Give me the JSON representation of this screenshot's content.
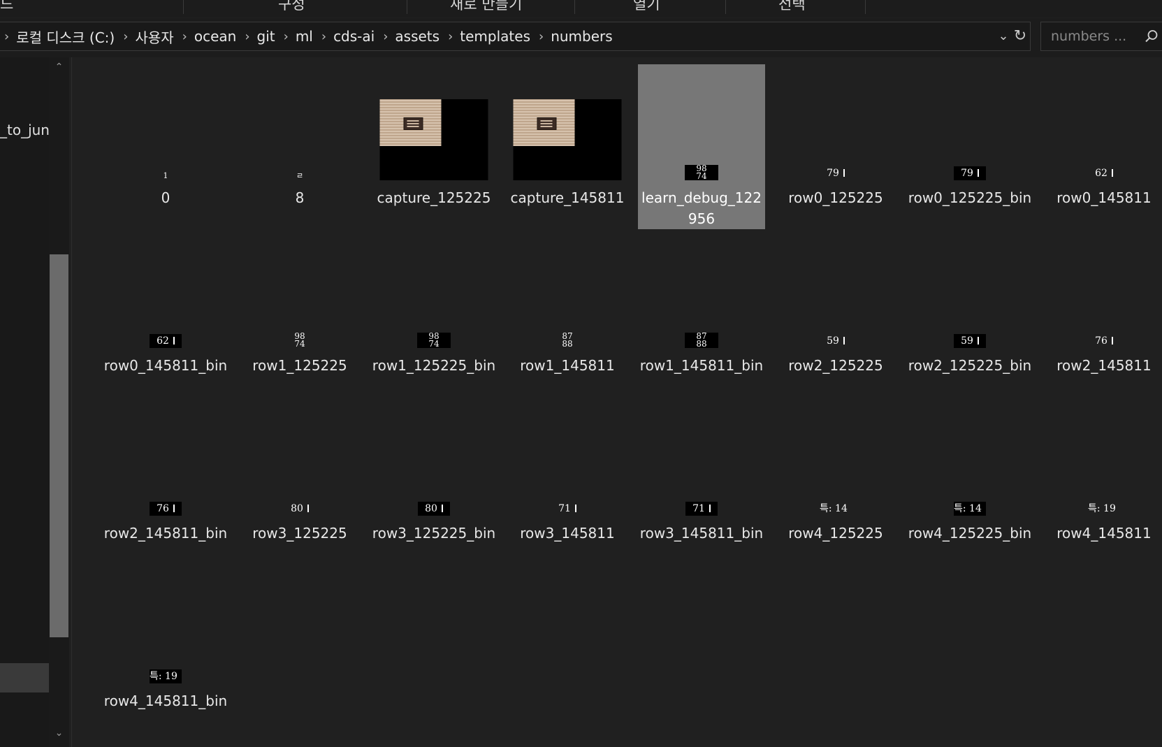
{
  "ribbon": {
    "items": [
      "드",
      "구성",
      "새로 만들기",
      "열기",
      "선택"
    ]
  },
  "address": {
    "crumbs": [
      "로컬 디스크 (C:)",
      "사용자",
      "ocean",
      "git",
      "ml",
      "cds-ai",
      "assets",
      "templates",
      "numbers"
    ],
    "dropdown_icon": "chevron-down-icon",
    "refresh_icon": "refresh-icon"
  },
  "search": {
    "placeholder": "numbers ..."
  },
  "nav": {
    "partial_item": "_to_jun"
  },
  "files": [
    {
      "name": "0",
      "thumb_text": "1",
      "thumb_kind": "text"
    },
    {
      "name": "8",
      "thumb_text": "ㄹ",
      "thumb_kind": "text"
    },
    {
      "name": "capture_125225",
      "thumb_kind": "capture"
    },
    {
      "name": "capture_145811",
      "thumb_kind": "capture"
    },
    {
      "name": "learn_debug_122956",
      "thumb_text": "98 74",
      "thumb_kind": "bin",
      "selected": true
    },
    {
      "name": "row0_125225",
      "thumb_text": "79",
      "thumb_kind": "text"
    },
    {
      "name": "row0_125225_bin",
      "thumb_text": "79",
      "thumb_kind": "bin"
    },
    {
      "name": "row0_145811",
      "thumb_text": "62",
      "thumb_kind": "text"
    },
    {
      "name": "row0_145811_bin",
      "thumb_text": "62",
      "thumb_kind": "bin"
    },
    {
      "name": "row1_125225",
      "thumb_text": "98 74",
      "thumb_kind": "text"
    },
    {
      "name": "row1_125225_bin",
      "thumb_text": "98 74",
      "thumb_kind": "bin"
    },
    {
      "name": "row1_145811",
      "thumb_text": "87 88",
      "thumb_kind": "text"
    },
    {
      "name": "row1_145811_bin",
      "thumb_text": "87 88",
      "thumb_kind": "bin"
    },
    {
      "name": "row2_125225",
      "thumb_text": "59",
      "thumb_kind": "text"
    },
    {
      "name": "row2_125225_bin",
      "thumb_text": "59",
      "thumb_kind": "bin"
    },
    {
      "name": "row2_145811",
      "thumb_text": "76",
      "thumb_kind": "text"
    },
    {
      "name": "row2_145811_bin",
      "thumb_text": "76",
      "thumb_kind": "bin"
    },
    {
      "name": "row3_125225",
      "thumb_text": "80",
      "thumb_kind": "text"
    },
    {
      "name": "row3_125225_bin",
      "thumb_text": "80",
      "thumb_kind": "bin"
    },
    {
      "name": "row3_145811",
      "thumb_text": "71",
      "thumb_kind": "text"
    },
    {
      "name": "row3_145811_bin",
      "thumb_text": "71",
      "thumb_kind": "bin"
    },
    {
      "name": "row4_125225",
      "thumb_text": "특: 14",
      "thumb_kind": "text"
    },
    {
      "name": "row4_125225_bin",
      "thumb_text": "특: 14",
      "thumb_kind": "bin"
    },
    {
      "name": "row4_145811",
      "thumb_text": "특: 19",
      "thumb_kind": "text"
    },
    {
      "name": "row4_145811_bin",
      "thumb_text": "특: 19",
      "thumb_kind": "bin"
    }
  ],
  "colors": {
    "background": "#202020",
    "selected_tile": "#777777",
    "scroll_thumb": "#6b6b6b"
  }
}
